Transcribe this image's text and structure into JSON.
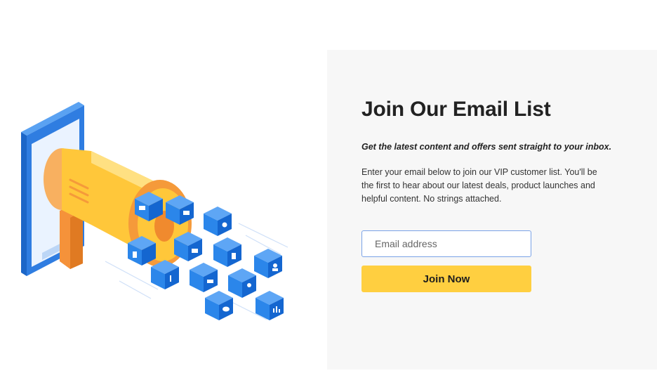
{
  "signup": {
    "title": "Join Our Email List",
    "subtitle": "Get the latest content and offers sent straight to your inbox.",
    "body": "Enter your email below to join our VIP customer list. You'll be the first to hear about our latest deals, product launches and helpful content. No strings attached.",
    "email_placeholder": "Email address",
    "email_value": "",
    "button_label": "Join Now"
  },
  "colors": {
    "panel_background": "#f7f7f7",
    "button_background": "#ffcf40",
    "input_border": "#7aa2e6",
    "phone_blue": "#2f7de1",
    "megaphone_yellow": "#ffc73a",
    "megaphone_orange": "#f59a3a",
    "cube_blue": "#1f7be6"
  },
  "illustration": {
    "device": "phone-icon",
    "object": "megaphone-icon",
    "cube_icons": [
      "video-icon",
      "mail-icon",
      "lightbulb-icon",
      "document-icon",
      "camera-icon",
      "tablet-icon",
      "music-icon",
      "cart-icon",
      "location-pin-icon",
      "user-icon",
      "chat-icon",
      "bar-chart-icon"
    ]
  }
}
